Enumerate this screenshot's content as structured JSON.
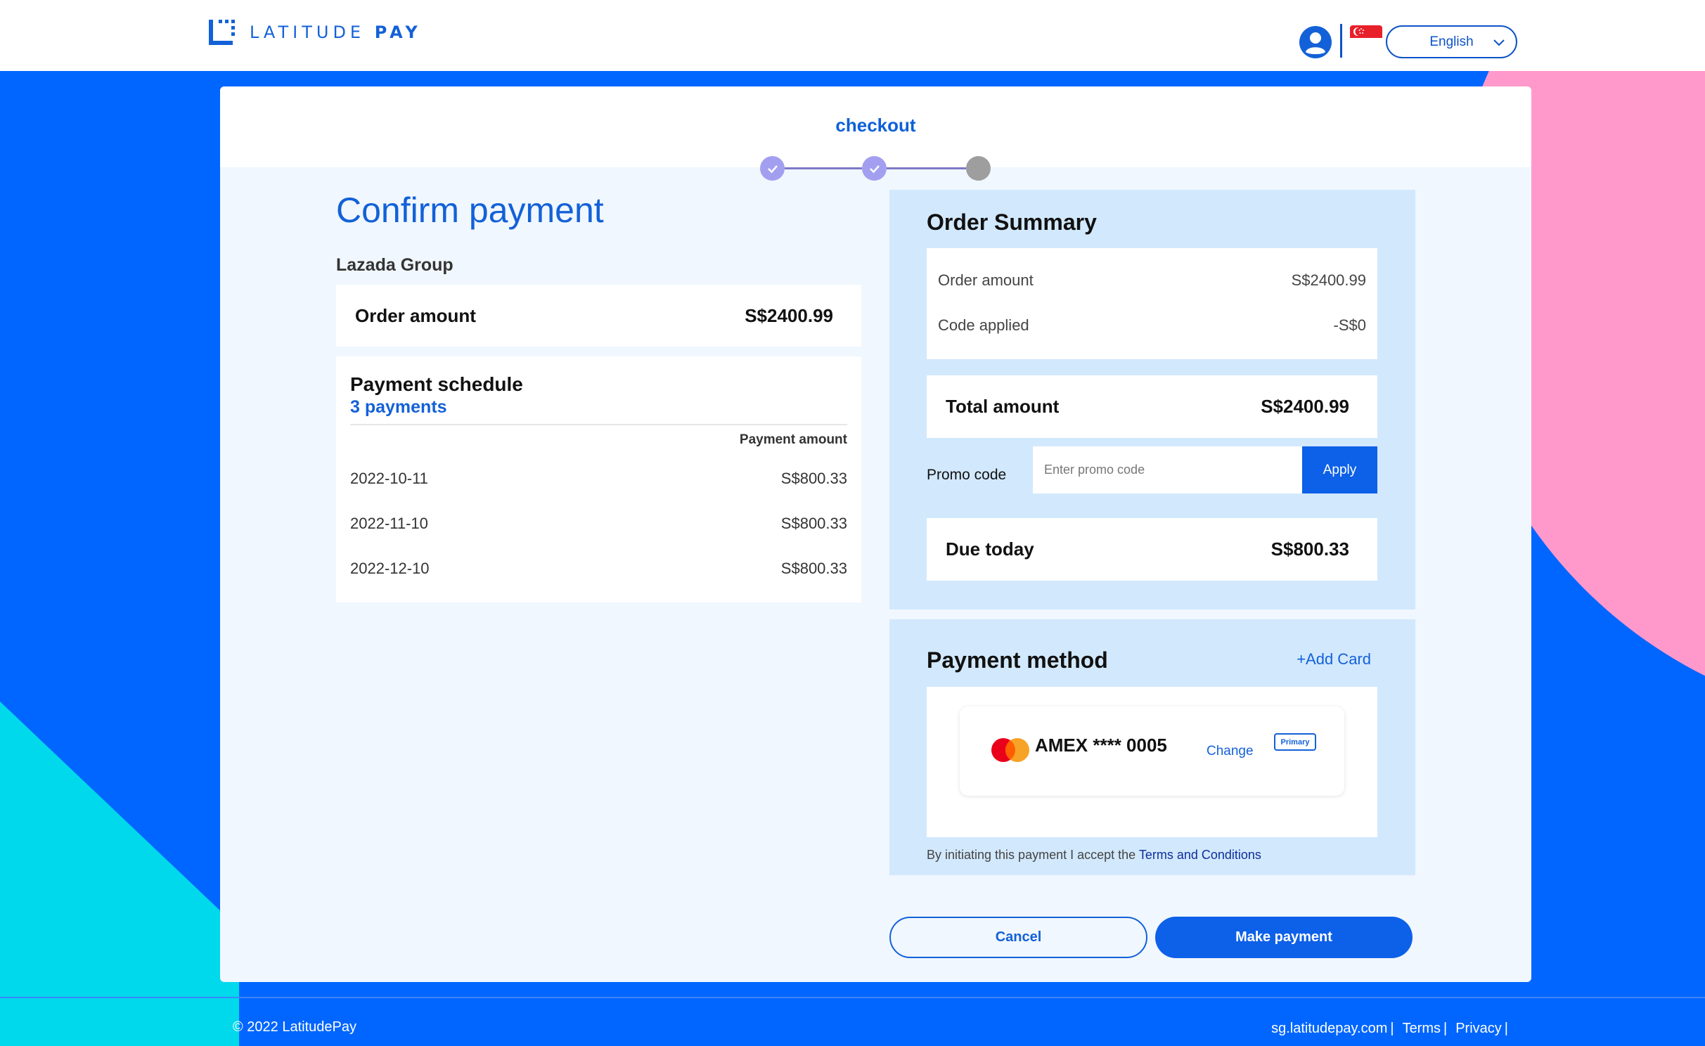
{
  "header": {
    "brand_light": "LATITUDE",
    "brand_bold": "PAY",
    "language": "English"
  },
  "checkout": {
    "title": "checkout",
    "steps": [
      "done",
      "done",
      "todo"
    ]
  },
  "confirm": {
    "title": "Confirm payment",
    "merchant": "Lazada Group",
    "order_label": "Order amount",
    "order_value": "S$2400.99"
  },
  "schedule": {
    "title": "Payment schedule",
    "count": "3 payments",
    "column_header": "Payment amount",
    "rows": [
      {
        "date": "2022-10-11",
        "amount": "S$800.33"
      },
      {
        "date": "2022-11-10",
        "amount": "S$800.33"
      },
      {
        "date": "2022-12-10",
        "amount": "S$800.33"
      }
    ]
  },
  "summary": {
    "title": "Order Summary",
    "lines": [
      {
        "label": "Order amount",
        "value": "S$2400.99"
      },
      {
        "label": "Code applied",
        "value": "-S$0"
      }
    ],
    "total_label": "Total amount",
    "total_value": "S$2400.99",
    "promo_label": "Promo code",
    "promo_placeholder": "Enter promo code",
    "apply_label": "Apply",
    "due_label": "Due today",
    "due_value": "S$800.33"
  },
  "payment_method": {
    "title": "Payment method",
    "add_card": "+Add Card",
    "card_number": "AMEX **** 0005",
    "change_label": "Change",
    "badge": "Primary",
    "terms_prefix": "By initiating this payment I accept the ",
    "terms_link": "Terms and Conditions"
  },
  "actions": {
    "cancel": "Cancel",
    "make_payment": "Make payment"
  },
  "footer": {
    "copyright": "© 2022 LatitudePay",
    "links": [
      "sg.latitudepay.com",
      "Terms",
      "Privacy"
    ],
    "separator": "|"
  },
  "colors": {
    "brand_blue": "#0066ff",
    "accent_blue": "#1361d8",
    "pink": "#ff99cc",
    "cyan": "#00d9ec"
  }
}
